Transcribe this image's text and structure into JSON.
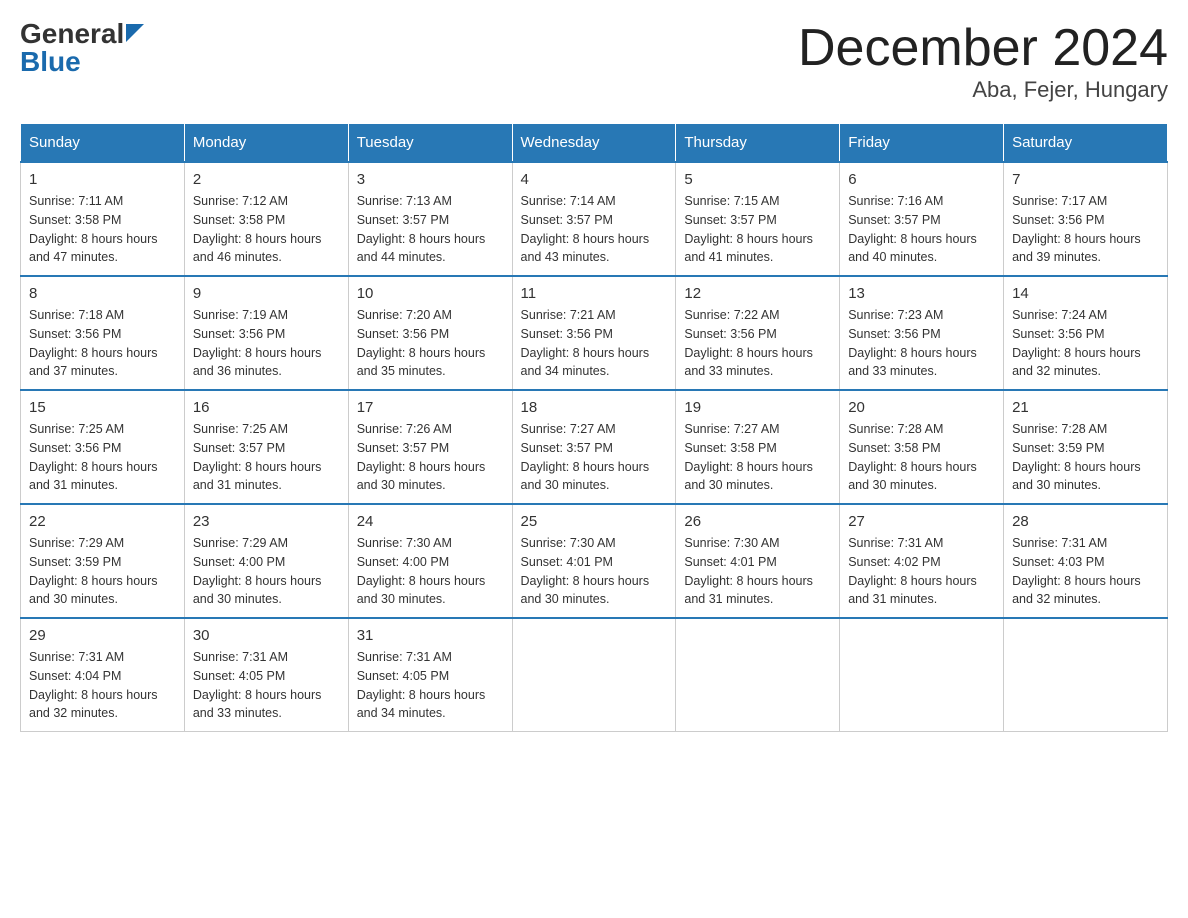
{
  "header": {
    "logo": {
      "general": "General",
      "blue": "Blue"
    },
    "title": "December 2024",
    "location": "Aba, Fejer, Hungary"
  },
  "days_of_week": [
    "Sunday",
    "Monday",
    "Tuesday",
    "Wednesday",
    "Thursday",
    "Friday",
    "Saturday"
  ],
  "weeks": [
    [
      {
        "day": "1",
        "sunrise": "7:11 AM",
        "sunset": "3:58 PM",
        "daylight": "8 hours and 47 minutes."
      },
      {
        "day": "2",
        "sunrise": "7:12 AM",
        "sunset": "3:58 PM",
        "daylight": "8 hours and 46 minutes."
      },
      {
        "day": "3",
        "sunrise": "7:13 AM",
        "sunset": "3:57 PM",
        "daylight": "8 hours and 44 minutes."
      },
      {
        "day": "4",
        "sunrise": "7:14 AM",
        "sunset": "3:57 PM",
        "daylight": "8 hours and 43 minutes."
      },
      {
        "day": "5",
        "sunrise": "7:15 AM",
        "sunset": "3:57 PM",
        "daylight": "8 hours and 41 minutes."
      },
      {
        "day": "6",
        "sunrise": "7:16 AM",
        "sunset": "3:57 PM",
        "daylight": "8 hours and 40 minutes."
      },
      {
        "day": "7",
        "sunrise": "7:17 AM",
        "sunset": "3:56 PM",
        "daylight": "8 hours and 39 minutes."
      }
    ],
    [
      {
        "day": "8",
        "sunrise": "7:18 AM",
        "sunset": "3:56 PM",
        "daylight": "8 hours and 37 minutes."
      },
      {
        "day": "9",
        "sunrise": "7:19 AM",
        "sunset": "3:56 PM",
        "daylight": "8 hours and 36 minutes."
      },
      {
        "day": "10",
        "sunrise": "7:20 AM",
        "sunset": "3:56 PM",
        "daylight": "8 hours and 35 minutes."
      },
      {
        "day": "11",
        "sunrise": "7:21 AM",
        "sunset": "3:56 PM",
        "daylight": "8 hours and 34 minutes."
      },
      {
        "day": "12",
        "sunrise": "7:22 AM",
        "sunset": "3:56 PM",
        "daylight": "8 hours and 33 minutes."
      },
      {
        "day": "13",
        "sunrise": "7:23 AM",
        "sunset": "3:56 PM",
        "daylight": "8 hours and 33 minutes."
      },
      {
        "day": "14",
        "sunrise": "7:24 AM",
        "sunset": "3:56 PM",
        "daylight": "8 hours and 32 minutes."
      }
    ],
    [
      {
        "day": "15",
        "sunrise": "7:25 AM",
        "sunset": "3:56 PM",
        "daylight": "8 hours and 31 minutes."
      },
      {
        "day": "16",
        "sunrise": "7:25 AM",
        "sunset": "3:57 PM",
        "daylight": "8 hours and 31 minutes."
      },
      {
        "day": "17",
        "sunrise": "7:26 AM",
        "sunset": "3:57 PM",
        "daylight": "8 hours and 30 minutes."
      },
      {
        "day": "18",
        "sunrise": "7:27 AM",
        "sunset": "3:57 PM",
        "daylight": "8 hours and 30 minutes."
      },
      {
        "day": "19",
        "sunrise": "7:27 AM",
        "sunset": "3:58 PM",
        "daylight": "8 hours and 30 minutes."
      },
      {
        "day": "20",
        "sunrise": "7:28 AM",
        "sunset": "3:58 PM",
        "daylight": "8 hours and 30 minutes."
      },
      {
        "day": "21",
        "sunrise": "7:28 AM",
        "sunset": "3:59 PM",
        "daylight": "8 hours and 30 minutes."
      }
    ],
    [
      {
        "day": "22",
        "sunrise": "7:29 AM",
        "sunset": "3:59 PM",
        "daylight": "8 hours and 30 minutes."
      },
      {
        "day": "23",
        "sunrise": "7:29 AM",
        "sunset": "4:00 PM",
        "daylight": "8 hours and 30 minutes."
      },
      {
        "day": "24",
        "sunrise": "7:30 AM",
        "sunset": "4:00 PM",
        "daylight": "8 hours and 30 minutes."
      },
      {
        "day": "25",
        "sunrise": "7:30 AM",
        "sunset": "4:01 PM",
        "daylight": "8 hours and 30 minutes."
      },
      {
        "day": "26",
        "sunrise": "7:30 AM",
        "sunset": "4:01 PM",
        "daylight": "8 hours and 31 minutes."
      },
      {
        "day": "27",
        "sunrise": "7:31 AM",
        "sunset": "4:02 PM",
        "daylight": "8 hours and 31 minutes."
      },
      {
        "day": "28",
        "sunrise": "7:31 AM",
        "sunset": "4:03 PM",
        "daylight": "8 hours and 32 minutes."
      }
    ],
    [
      {
        "day": "29",
        "sunrise": "7:31 AM",
        "sunset": "4:04 PM",
        "daylight": "8 hours and 32 minutes."
      },
      {
        "day": "30",
        "sunrise": "7:31 AM",
        "sunset": "4:05 PM",
        "daylight": "8 hours and 33 minutes."
      },
      {
        "day": "31",
        "sunrise": "7:31 AM",
        "sunset": "4:05 PM",
        "daylight": "8 hours and 34 minutes."
      },
      null,
      null,
      null,
      null
    ]
  ]
}
